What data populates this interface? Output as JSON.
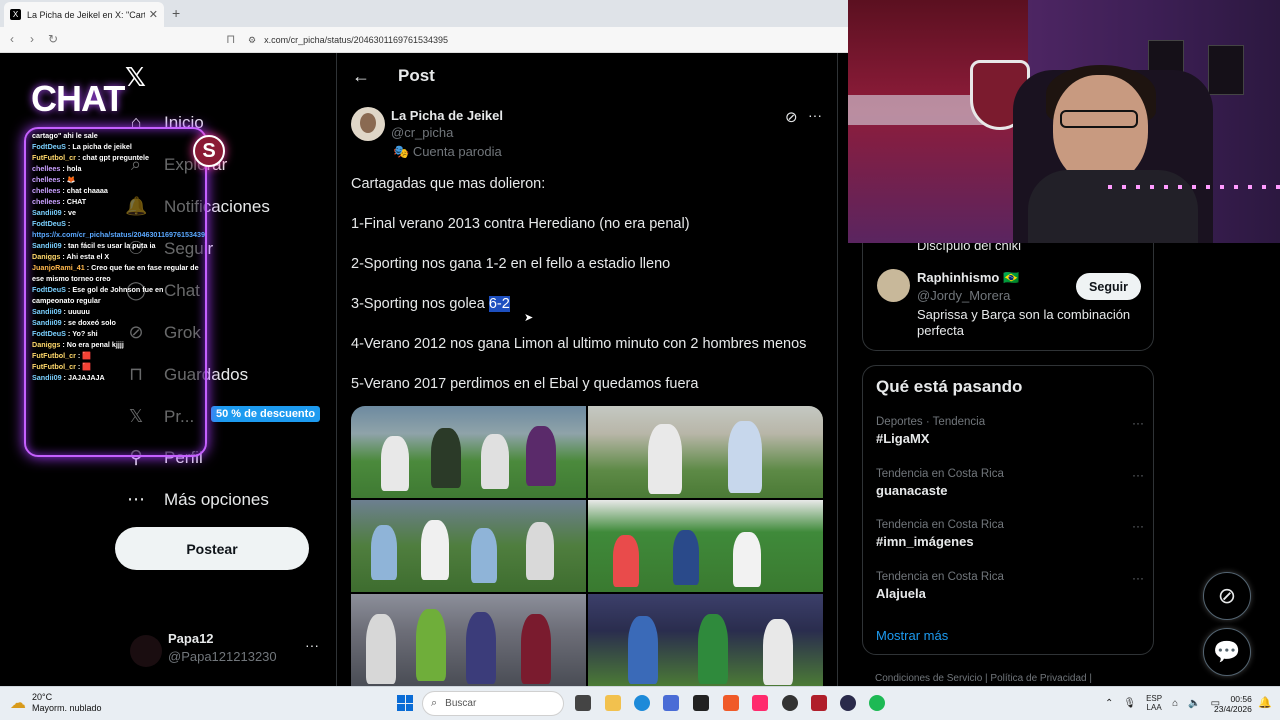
{
  "browser": {
    "tab_title": "La Picha de Jeikel en X: \"Cartag",
    "tab_close": "✕",
    "new_tab": "+",
    "url": "x.com/cr_picha/status/2046301169761534395"
  },
  "nav": {
    "logo": "𝕏",
    "items": [
      {
        "icon": "⌂",
        "label": "Inicio"
      },
      {
        "icon": "⌕",
        "label": "Explorar"
      },
      {
        "icon": "🔔",
        "label": "Notificaciones"
      },
      {
        "icon": "⚇",
        "label": "Seguir"
      },
      {
        "icon": "◯",
        "label": "Chat"
      },
      {
        "icon": "⊘",
        "label": "Grok"
      },
      {
        "icon": "⊓",
        "label": "Guardados"
      },
      {
        "icon": "𝕏",
        "label": "Pr..."
      },
      {
        "icon": "⚲",
        "label": "Perfil"
      },
      {
        "icon": "⋯",
        "label": "Más opciones"
      }
    ],
    "premium_badge": "50 % de descuento",
    "post_button": "Postear",
    "account": {
      "name": "Papa12",
      "handle": "@Papa121213230",
      "more": "···"
    }
  },
  "chat": {
    "title": "CHAT",
    "logo_letter": "S",
    "lines": [
      {
        "user": "",
        "text": "cartago\" ahi le sale",
        "cls": ""
      },
      {
        "user": "FodtDeuS",
        "text": "La picha de jeikel",
        "cls": "u3"
      },
      {
        "user": "FutFutbol_cr",
        "text": "chat gpt preguntele",
        "cls": "u4"
      },
      {
        "user": "chellees",
        "text": "hola",
        "cls": "u2"
      },
      {
        "user": "chellees",
        "text": "🦊",
        "cls": "u2"
      },
      {
        "user": "chellees",
        "text": "chat chaaaa",
        "cls": "u2"
      },
      {
        "user": "chellees",
        "text": "CHAT",
        "cls": "u2"
      },
      {
        "user": "Sandii09",
        "text": "ve",
        "cls": "u3"
      },
      {
        "user": "FodtDeuS",
        "text": "",
        "cls": "u3"
      },
      {
        "user": "",
        "text": "https://x.com/cr_picha/status/2046301169761534395",
        "cls": "lk"
      },
      {
        "user": "Sandii09",
        "text": "tan fácil es usar la puta ia",
        "cls": "u3"
      },
      {
        "user": "Daniggs",
        "text": "Ahi esta el X",
        "cls": "u4"
      },
      {
        "user": "JuanjoRami_41",
        "text": "Creo que fue en fase regular de ese mismo torneo creo",
        "cls": "u1"
      },
      {
        "user": "FodtDeuS",
        "text": "Ese gol de Johnson fue en campeonato regular",
        "cls": "u3"
      },
      {
        "user": "Sandii09",
        "text": "uuuuu",
        "cls": "u3"
      },
      {
        "user": "Sandii09",
        "text": "se doxeó solo",
        "cls": "u3"
      },
      {
        "user": "FodtDeuS",
        "text": "Yo? shi",
        "cls": "u3"
      },
      {
        "user": "Daniggs",
        "text": "No era penal kjjjj",
        "cls": "u4"
      },
      {
        "user": "FutFutbol_cr",
        "text": "🟥",
        "cls": "u4"
      },
      {
        "user": "FutFutbol_cr",
        "text": "🟥",
        "cls": "u4"
      },
      {
        "user": "Sandii09",
        "text": "JAJAJAJA",
        "cls": "u3"
      }
    ]
  },
  "post": {
    "header_title": "Post",
    "back_icon": "←",
    "author_name": "La Picha de Jeikel",
    "author_handle": "@cr_picha",
    "parody_label": "Cuenta parodia",
    "grok_icon": "⊘",
    "more": "···",
    "lines": [
      {
        "before": "Cartagadas que mas dolieron:",
        "hl": "",
        "after": ""
      },
      {
        "before": "1-Final verano 2013 contra Herediano (no era penal)",
        "hl": "",
        "after": ""
      },
      {
        "before": "2-Sporting nos gana 1-2 en el fello a estadio lleno",
        "hl": "",
        "after": ""
      },
      {
        "before": "3-Sporting  nos golea ",
        "hl": "6-2",
        "after": ""
      },
      {
        "before": "4-Verano 2012 nos gana Limon al ultimo minuto con 2 hombres menos",
        "hl": "",
        "after": ""
      },
      {
        "before": "5-Verano 2017 perdimos en el Ebal y quedamos fuera",
        "hl": "",
        "after": ""
      }
    ]
  },
  "right": {
    "prev_text": "Discípulo del chiki",
    "who": {
      "name": "Raphinhismo 🇧🇷",
      "handle": "@Jordy_Morera",
      "follow": "Seguir",
      "bio": "Saprissa y Barça son la combinación perfecta"
    },
    "trends_title": "Qué está pasando",
    "trends": [
      {
        "context": "Deportes · Tendencia",
        "name": "#LigaMX"
      },
      {
        "context": "Tendencia en Costa Rica",
        "name": "guanacaste"
      },
      {
        "context": "Tendencia en Costa Rica",
        "name": "#imn_imágenes"
      },
      {
        "context": "Tendencia en Costa Rica",
        "name": "Alajuela"
      }
    ],
    "show_more": "Mostrar más",
    "footer": "Condiciones de Servicio  |  Política de Privacidad  |"
  },
  "taskbar": {
    "weather_temp": "20°C",
    "weather_desc": "Mayorm. nublado",
    "search_placeholder": "Buscar",
    "lang_top": "ESP",
    "lang_bottom": "LAA",
    "time": "00:56",
    "date": "23/4/2026"
  }
}
